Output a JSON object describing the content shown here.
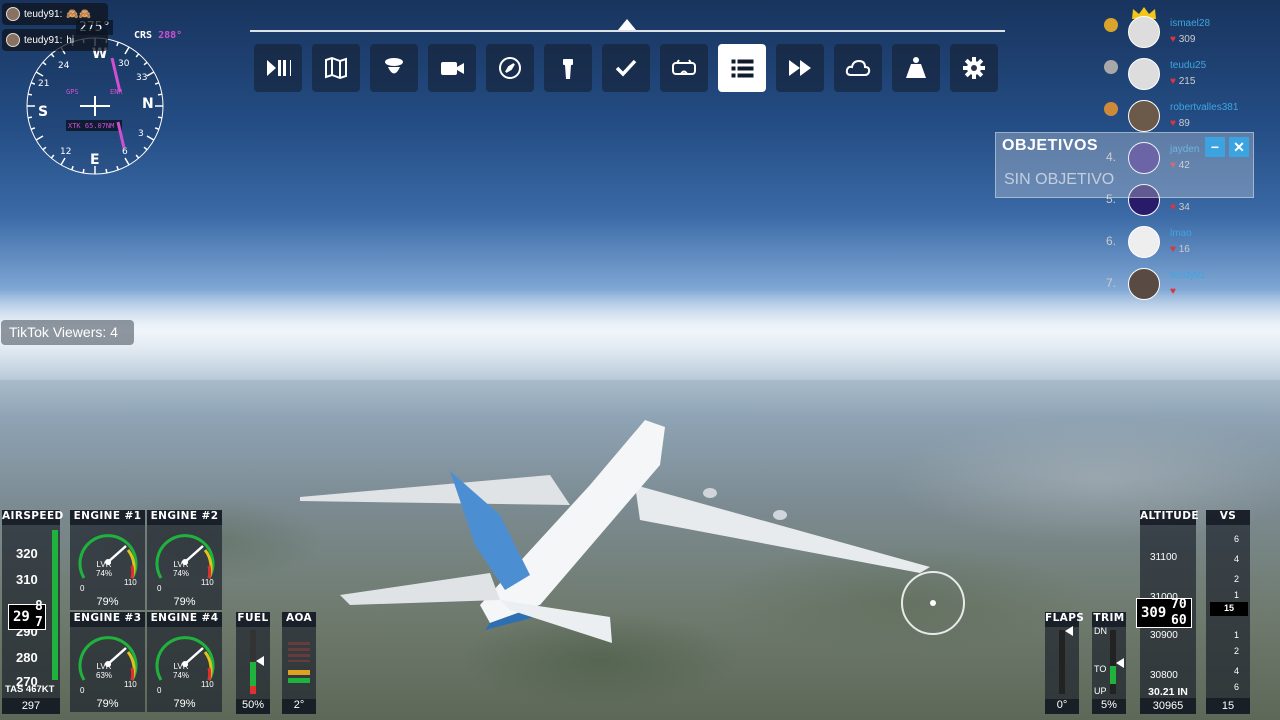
{
  "chat": [
    {
      "user": "teudy91:",
      "msg": "🙈🙈"
    },
    {
      "user": "teudy91:",
      "msg": "hi"
    }
  ],
  "compass": {
    "heading": "275°",
    "crs_label": "CRS",
    "crs_value": "288°",
    "labels": {
      "gps": "GPS",
      "enr": "ENR",
      "xtk": "XTK 65.07NM"
    },
    "cardinals": {
      "n": "N",
      "e": "E",
      "s": "S",
      "w": "W"
    },
    "numbers": [
      "33",
      "30",
      "24",
      "21",
      "12",
      "3",
      "6"
    ]
  },
  "toolbar": {
    "items": [
      {
        "name": "pause-play",
        "icon": "play-pause-icon"
      },
      {
        "name": "map",
        "icon": "map-icon"
      },
      {
        "name": "pilot",
        "icon": "pilot-icon"
      },
      {
        "name": "camera",
        "icon": "camera-icon"
      },
      {
        "name": "navlog",
        "icon": "compass-icon"
      },
      {
        "name": "atc",
        "icon": "atc-tower-icon"
      },
      {
        "name": "checklist",
        "icon": "checkmark-icon"
      },
      {
        "name": "vr",
        "icon": "vr-headset-icon"
      },
      {
        "name": "objectives",
        "icon": "list-icon",
        "active": true
      },
      {
        "name": "sim-rate",
        "icon": "fast-forward-icon"
      },
      {
        "name": "weather",
        "icon": "cloud-icon"
      },
      {
        "name": "weight",
        "icon": "weight-icon"
      },
      {
        "name": "settings",
        "icon": "gear-icon"
      }
    ]
  },
  "leaderboard": [
    {
      "rank": "",
      "name": "ismael28",
      "score": "309",
      "medal": "#d9a42c"
    },
    {
      "rank": "",
      "name": "teudu25",
      "score": "215",
      "medal": "#a8a8a8"
    },
    {
      "rank": "",
      "name": "robertvalles381",
      "score": "89",
      "medal": "#cc8a3a"
    },
    {
      "rank": "4.",
      "name": "jayden",
      "score": "42"
    },
    {
      "rank": "5.",
      "name": "",
      "score": "34"
    },
    {
      "rank": "6.",
      "name": "lmao",
      "score": "16"
    },
    {
      "rank": "7.",
      "name": "teudy91",
      "score": ""
    }
  ],
  "objectives": {
    "title": "OBJETIVOS",
    "subtitle": "SIN OBJETIVO",
    "minimize": "−",
    "close": "✕"
  },
  "tiktok": "TikTok Viewers: 4",
  "airspeed": {
    "title": "AIRSPEED",
    "ticks": [
      "320",
      "310",
      "290",
      "280",
      "270"
    ],
    "current_main": "29",
    "current_upper": "8",
    "current_lower": "7",
    "tas": "TAS 467KT",
    "bottom": "297"
  },
  "engines": [
    {
      "title": "ENGINE #1",
      "lvr": "LVR",
      "lvr_pct": "74%",
      "pct": "79%"
    },
    {
      "title": "ENGINE #2",
      "lvr": "LVR",
      "lvr_pct": "74%",
      "pct": "79%"
    },
    {
      "title": "ENGINE #3",
      "lvr": "LVR",
      "lvr_pct": "63%",
      "pct": "79%"
    },
    {
      "title": "ENGINE #4",
      "lvr": "LVR",
      "lvr_pct": "74%",
      "pct": "79%"
    }
  ],
  "engine_scale": {
    "min": "0",
    "max": "110"
  },
  "fuel": {
    "title": "FUEL",
    "value": "50%",
    "level": 0.5
  },
  "aoa": {
    "title": "AOA",
    "value": "2°"
  },
  "flaps": {
    "title": "FLAPS",
    "value": "0°"
  },
  "trim": {
    "title": "TRIM",
    "dn": "DN",
    "to": "TO",
    "up": "UP",
    "value": "5%"
  },
  "altitude": {
    "title": "ALTITUDE",
    "ticks": [
      "31100",
      "31000",
      "30900",
      "30800"
    ],
    "current_main": "309",
    "current_upper": "70",
    "current_lower": "60",
    "baro": "30.21 IN",
    "bottom": "30965"
  },
  "vs": {
    "title": "VS",
    "ticks": [
      "6",
      "4",
      "2",
      "1",
      "1",
      "2",
      "4",
      "6"
    ],
    "current": "15",
    "bottom": "15"
  },
  "colors": {
    "accent": "#3ba3e0",
    "green": "#1fb23c",
    "magenta": "#d04fd0"
  }
}
